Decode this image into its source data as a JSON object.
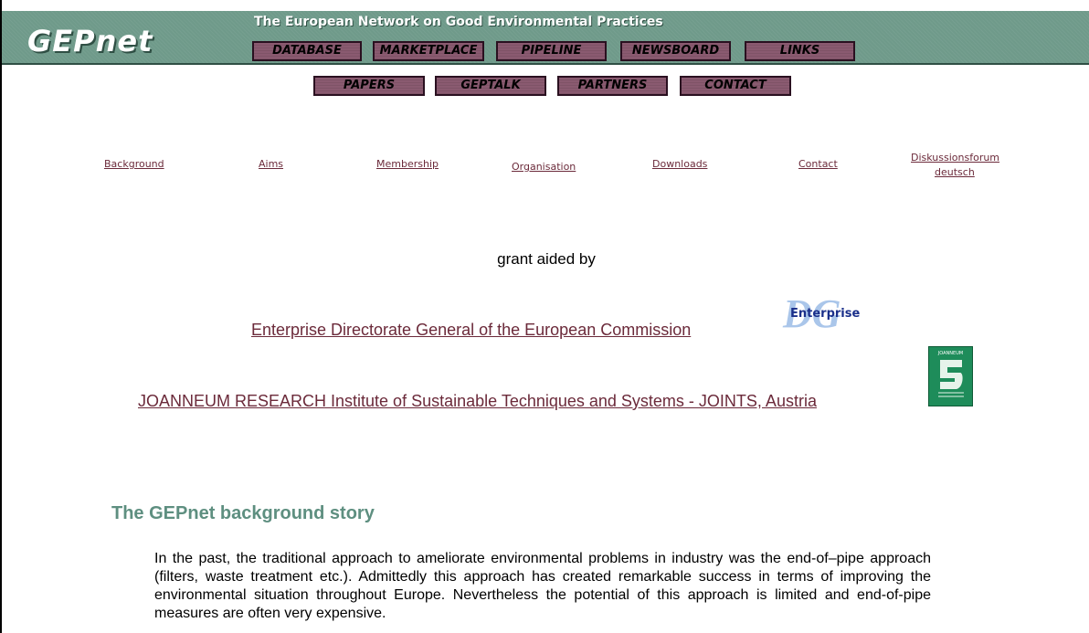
{
  "header": {
    "logo": "GEPnet",
    "tagline": "The European Network on Good Environmental Practices",
    "nav_row1": [
      "DATABASE",
      "MARKETPLACE",
      "PIPELINE",
      "NEWSBOARD",
      "LINKS"
    ],
    "nav_row2": [
      "PAPERS",
      "GEPTALK",
      "PARTNERS",
      "CONTACT"
    ]
  },
  "subnav": [
    "Background",
    "Aims",
    "Membership",
    "Organisation",
    "Downloads",
    "Contact",
    "Diskussionsforum",
    "deutsch"
  ],
  "grant": {
    "label": "grant aided by",
    "link1": "Enterprise Directorate General of the European Commission",
    "link2": "JOANNEUM RESEARCH Institute of Sustainable Techniques and Systems - JOINTS, Austria",
    "dg_logo_letters": "DG",
    "dg_logo_word": "Enterprise",
    "jr_logo_text": "JOANNEUM"
  },
  "content": {
    "title": "The GEPnet background story",
    "paragraph": "In the past, the traditional approach to ameliorate environmental problems in industry was the end-of–pipe approach (filters, waste treatment etc.). Admittedly this approach has created remarkable success in terms of improving the environmental situation throughout Europe. Nevertheless the potential of this approach is limited and end-of-pipe measures are often very expensive."
  },
  "colors": {
    "header_bg": "#6f9a8a",
    "nav_button": "#8a5a70",
    "link": "#6b2a3a",
    "section_title": "#5e8f80"
  }
}
